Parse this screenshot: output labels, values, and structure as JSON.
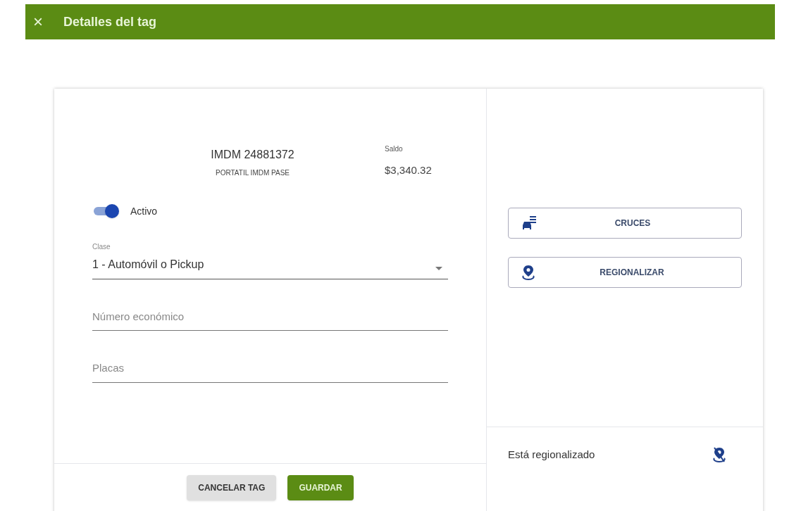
{
  "header": {
    "close": "×",
    "title": "Detalles del tag"
  },
  "tag": {
    "id": "IMDM 24881372",
    "description": "PORTATIL IMDM PASE",
    "balance_label": "Saldo",
    "balance": "$3,340.32"
  },
  "active_toggle": {
    "label": "Activo",
    "on": true
  },
  "class_select": {
    "label": "Clase",
    "value": "1 - Automóvil o Pickup"
  },
  "fields": [
    {
      "placeholder": "Número económico"
    },
    {
      "placeholder": "Placas"
    }
  ],
  "footer_buttons": [
    {
      "label": "CANCELAR TAG",
      "kind": "secondary"
    },
    {
      "label": "GUARDAR",
      "kind": "primary"
    }
  ],
  "actions": [
    {
      "label": "CRUCES",
      "kind": "crossings"
    },
    {
      "label": "REGIONALIZAR",
      "kind": "regionalize"
    }
  ],
  "regionalized": {
    "label": "Está regionalizado",
    "on": false
  }
}
